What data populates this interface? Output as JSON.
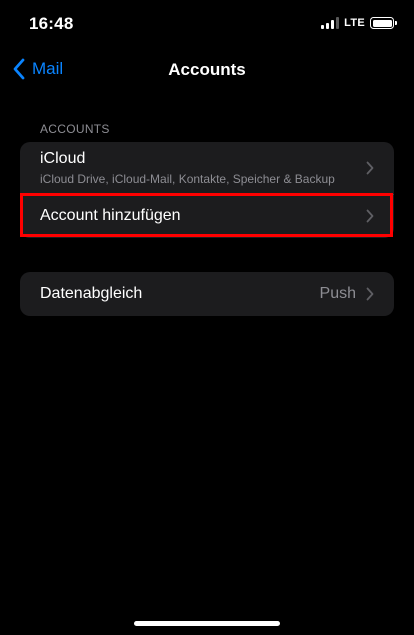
{
  "status_bar": {
    "time": "16:48",
    "network": "LTE",
    "signal_bars_active": 3,
    "signal_bars_total": 4,
    "battery_level": 1.0
  },
  "nav": {
    "back_label": "Mail",
    "title": "Accounts"
  },
  "accounts_section": {
    "header": "ACCOUNTS",
    "icloud": {
      "title": "iCloud",
      "subtitle": "iCloud Drive, iCloud-Mail, Kontakte, Speicher & Backup"
    },
    "add_account": {
      "title": "Account hinzufügen",
      "highlighted": true
    }
  },
  "sync_section": {
    "title": "Datenabgleich",
    "value": "Push"
  },
  "colors": {
    "accent": "#0a84ff",
    "highlight": "#ff0000",
    "cell_background": "#1c1c1e",
    "secondary_text": "#8d8d93"
  },
  "icons": {
    "back": "chevron-left-icon",
    "disclosure": "chevron-right-icon",
    "signal": "cellular-signal-icon",
    "battery": "battery-icon"
  }
}
